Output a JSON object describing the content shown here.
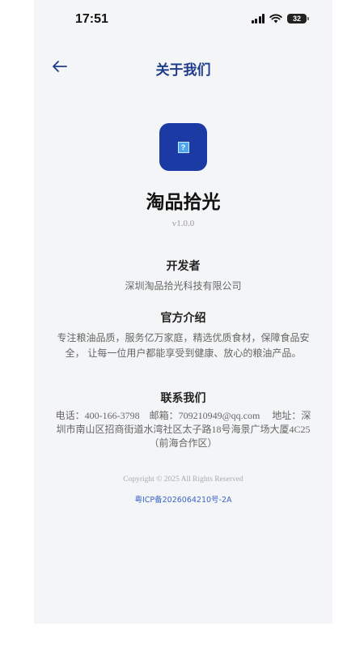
{
  "status_bar": {
    "time": "17:51",
    "battery": "32",
    "icons": [
      "cellular-signal-icon",
      "wifi-icon",
      "battery-icon"
    ]
  },
  "nav": {
    "back_icon": "arrow-left-icon",
    "title": "关于我们"
  },
  "app": {
    "logo_icon": "image-placeholder-icon",
    "logo_glyph": "?",
    "name": "淘品拾光",
    "version": "v1.0.0"
  },
  "sections": {
    "developer": {
      "title": "开发者",
      "text": "深圳淘品拾光科技有限公司"
    },
    "intro": {
      "title": "官方介绍",
      "text": "专注粮油品质，服务亿万家庭，精选优质食材，保障食品安全， 让每一位用户都能享受到健康、放心的粮油产品。"
    },
    "contact": {
      "title": "联系我们",
      "text": "电话：400-166-3798　邮箱：709210949@qq.com　 地址：深圳市南山区招商街道水湾社区太子路18号海景广场大厦4C25（前海合作区）"
    }
  },
  "footer": {
    "copyright": "Copyright © 2025 All Rights Reserved",
    "icp": "粤ICP备2026064210号-2A"
  },
  "colors": {
    "accent": "#1f3b8c",
    "logo_bg": "#1b3aa3",
    "link": "#3a63c9",
    "background": "#f4f5f7"
  }
}
